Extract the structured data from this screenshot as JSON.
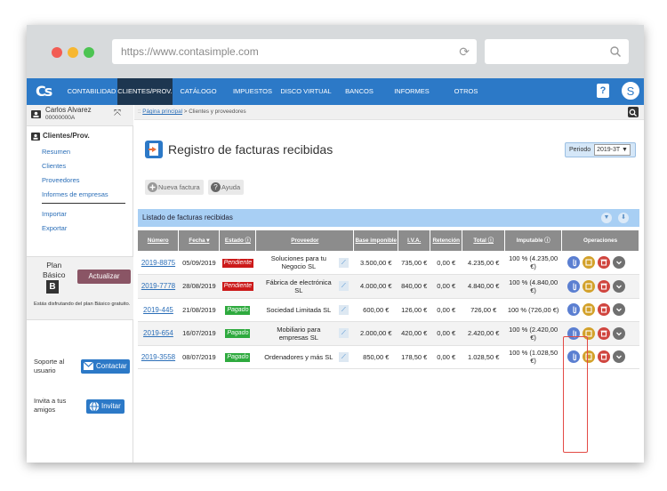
{
  "browser": {
    "url": "https://www.contasimple.com",
    "colors": {
      "close": "#f25c54",
      "minimize": "#f7b731",
      "maximize": "#4cc452"
    }
  },
  "nav": {
    "logo": "Cs",
    "items": [
      "CONTABILIDAD",
      "CLIENTES/PROV.",
      "CATÁLOGO",
      "IMPUESTOS",
      "DISCO VIRTUAL",
      "BANCOS",
      "INFORMES",
      "OTROS"
    ],
    "active_index": 1,
    "help": "?",
    "avatar_letter": "S"
  },
  "sidebar": {
    "user_name": "Carlos Alvarez",
    "user_id": "00000000A",
    "section": "Clientes/Prov.",
    "links": [
      "Resumen",
      "Clientes",
      "Proveedores",
      "Informes de empresas"
    ],
    "links2": [
      "Importar",
      "Exportar"
    ],
    "plan_label_1": "Plan",
    "plan_label_2": "Básico",
    "plan_badge": "B",
    "upgrade": "Actualizar",
    "plan_msg": "Estás disfrutando del plan Básico gratuito.",
    "support_1": "Soporte al",
    "support_2": "usuario",
    "contact": "Contactar",
    "invite_1": "Invita a tus",
    "invite_2": "amigos",
    "invite": "Invitar"
  },
  "main": {
    "breadcrumb_home": "Página principal",
    "breadcrumb_rest": " > Clientes y proveedores",
    "title": "Registro de facturas recibidas",
    "period_label": "Periodo",
    "period_value": "2019-3T ▼",
    "new_invoice": "Nueva factura",
    "help": "Ayuda",
    "list_title": "Listado de facturas recibidas"
  },
  "table": {
    "headers": {
      "numero": "Número",
      "fecha": "Fecha",
      "estado": "Estado",
      "proveedor": "Proveedor",
      "base": "Base imponible",
      "iva": "I.V.A.",
      "retencion": "Retención",
      "total": "Total",
      "imputable": "Imputable",
      "operaciones": "Operaciones"
    },
    "rows": [
      {
        "numero": "2019-8875",
        "fecha": "05/09/2019",
        "estado": "Pendiente",
        "proveedor": "Soluciones para tu Negocio SL",
        "base": "3.500,00 €",
        "iva": "735,00 €",
        "retencion": "0,00 €",
        "total": "4.235,00 €",
        "imputable": "100 % (4.235,00 €)"
      },
      {
        "numero": "2019-7778",
        "fecha": "28/08/2019",
        "estado": "Pendiente",
        "proveedor": "Fábrica de electrónica SL",
        "base": "4.000,00 €",
        "iva": "840,00 €",
        "retencion": "0,00 €",
        "total": "4.840,00 €",
        "imputable": "100 % (4.840,00 €)"
      },
      {
        "numero": "2019-445",
        "fecha": "21/08/2019",
        "estado": "Pagado",
        "proveedor": "Sociedad Limitada SL",
        "base": "600,00 €",
        "iva": "126,00 €",
        "retencion": "0,00 €",
        "total": "726,00 €",
        "imputable": "100 % (726,00 €)"
      },
      {
        "numero": "2019-654",
        "fecha": "16/07/2019",
        "estado": "Pagado",
        "proveedor": "Mobiliario para empresas SL",
        "base": "2.000,00 €",
        "iva": "420,00 €",
        "retencion": "0,00 €",
        "total": "2.420,00 €",
        "imputable": "100 % (2.420,00 €)"
      },
      {
        "numero": "2019-3558",
        "fecha": "08/07/2019",
        "estado": "Pagado",
        "proveedor": "Ordenadores y más SL",
        "base": "850,00 €",
        "iva": "178,50 €",
        "retencion": "0,00 €",
        "total": "1.028,50 €",
        "imputable": "100 % (1.028,50 €)"
      }
    ]
  },
  "colors": {
    "brand_blue": "#2c79c7",
    "nav_active": "#1d3650",
    "pending": "#cc1a1a",
    "paid": "#2eaa3e",
    "upgrade": "#8a5565"
  }
}
